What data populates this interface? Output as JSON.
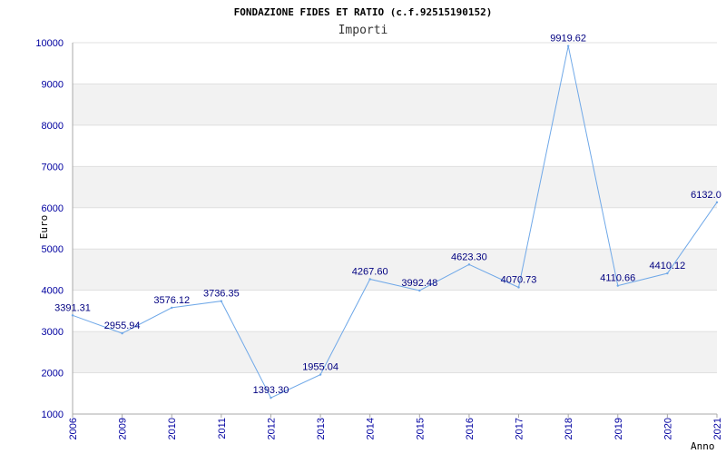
{
  "chart_data": {
    "type": "line",
    "title": "FONDAZIONE FIDES ET RATIO (c.f.92515190152)",
    "subtitle": "Importi",
    "xlabel": "Anno",
    "ylabel": "Euro",
    "ylim": [
      1000,
      10000
    ],
    "yticks": [
      "1000",
      "2000",
      "3000",
      "4000",
      "5000",
      "6000",
      "7000",
      "8000",
      "9000",
      "10000"
    ],
    "categories": [
      "2006",
      "2009",
      "2010",
      "2011",
      "2012",
      "2013",
      "2014",
      "2015",
      "2016",
      "2017",
      "2018",
      "2019",
      "2020",
      "2021"
    ],
    "series": [
      {
        "values": [
          3391.31,
          2955.94,
          3576.12,
          3736.35,
          1393.3,
          1955.04,
          4267.6,
          3992.48,
          4623.3,
          4070.73,
          9919.62,
          4110.66,
          4410.12,
          6132.0
        ],
        "labels": [
          "3391.31",
          "2955.94",
          "3576.12",
          "3736.35",
          "1393.30",
          "1955.04",
          "4267.60",
          "3992.48",
          "4623.30",
          "4070.73",
          "9919.62",
          "4110.66",
          "4410.12",
          "6132.0"
        ]
      }
    ],
    "grid": true,
    "colors": {
      "line": "#6fa8e8",
      "band": "#f2f2f2",
      "grid": "#e0e0e0",
      "axis": "#a8a8a8",
      "tick_text": "#0000a0",
      "data_label": "#000080"
    }
  }
}
